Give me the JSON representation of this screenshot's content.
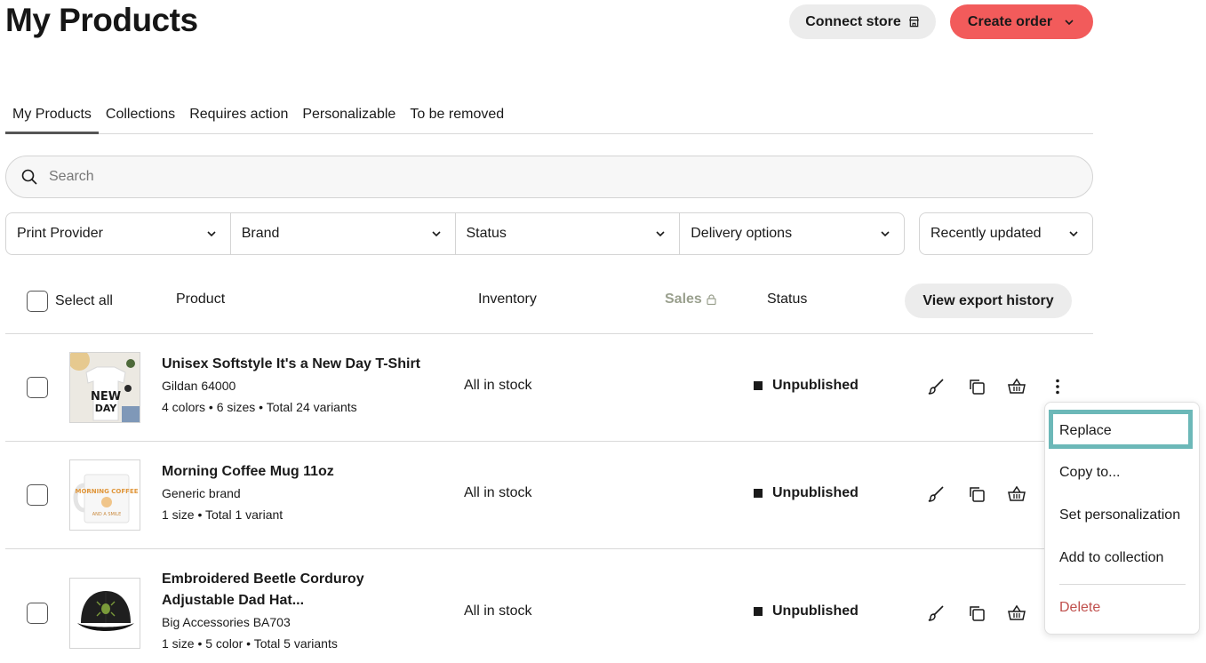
{
  "header": {
    "title": "My Products",
    "connect_store_label": "Connect store",
    "create_order_label": "Create order"
  },
  "tabs": [
    {
      "label": "My Products",
      "active": true
    },
    {
      "label": "Collections"
    },
    {
      "label": "Requires action"
    },
    {
      "label": "Personalizable"
    },
    {
      "label": "To be removed"
    }
  ],
  "search": {
    "placeholder": "Search"
  },
  "filters": {
    "print_provider": "Print Provider",
    "brand": "Brand",
    "status": "Status",
    "delivery_options": "Delivery options",
    "sort": "Recently updated"
  },
  "table": {
    "select_all": "Select all",
    "col_product": "Product",
    "col_inventory": "Inventory",
    "col_sales": "Sales",
    "col_status": "Status",
    "export_label": "View export history"
  },
  "products": [
    {
      "name": "Unisex Softstyle It's a New Day T-Shirt",
      "brand": "Gildan 64000",
      "variants": "4 colors • 6 sizes • Total 24 variants",
      "inventory": "All in stock",
      "status": "Unpublished"
    },
    {
      "name": "Morning Coffee Mug 11oz",
      "brand": "Generic brand",
      "variants": "1 size • Total 1 variant",
      "inventory": "All in stock",
      "status": "Unpublished"
    },
    {
      "name_line1": "Embroidered Beetle Corduroy",
      "name_line2": "Adjustable Dad Hat...",
      "brand": "Big Accessories BA703",
      "variants": "1 size • 5 color • Total 5 variants",
      "inventory": "All in stock",
      "status": "Unpublished"
    }
  ],
  "context_menu": {
    "replace": "Replace",
    "copy_to": "Copy to...",
    "set_personalization": "Set personalization",
    "add_to_collection": "Add to collection",
    "delete": "Delete"
  },
  "colors": {
    "accent": "#f25b5b",
    "highlight": "#6cb8b8",
    "danger": "#c0504d"
  }
}
